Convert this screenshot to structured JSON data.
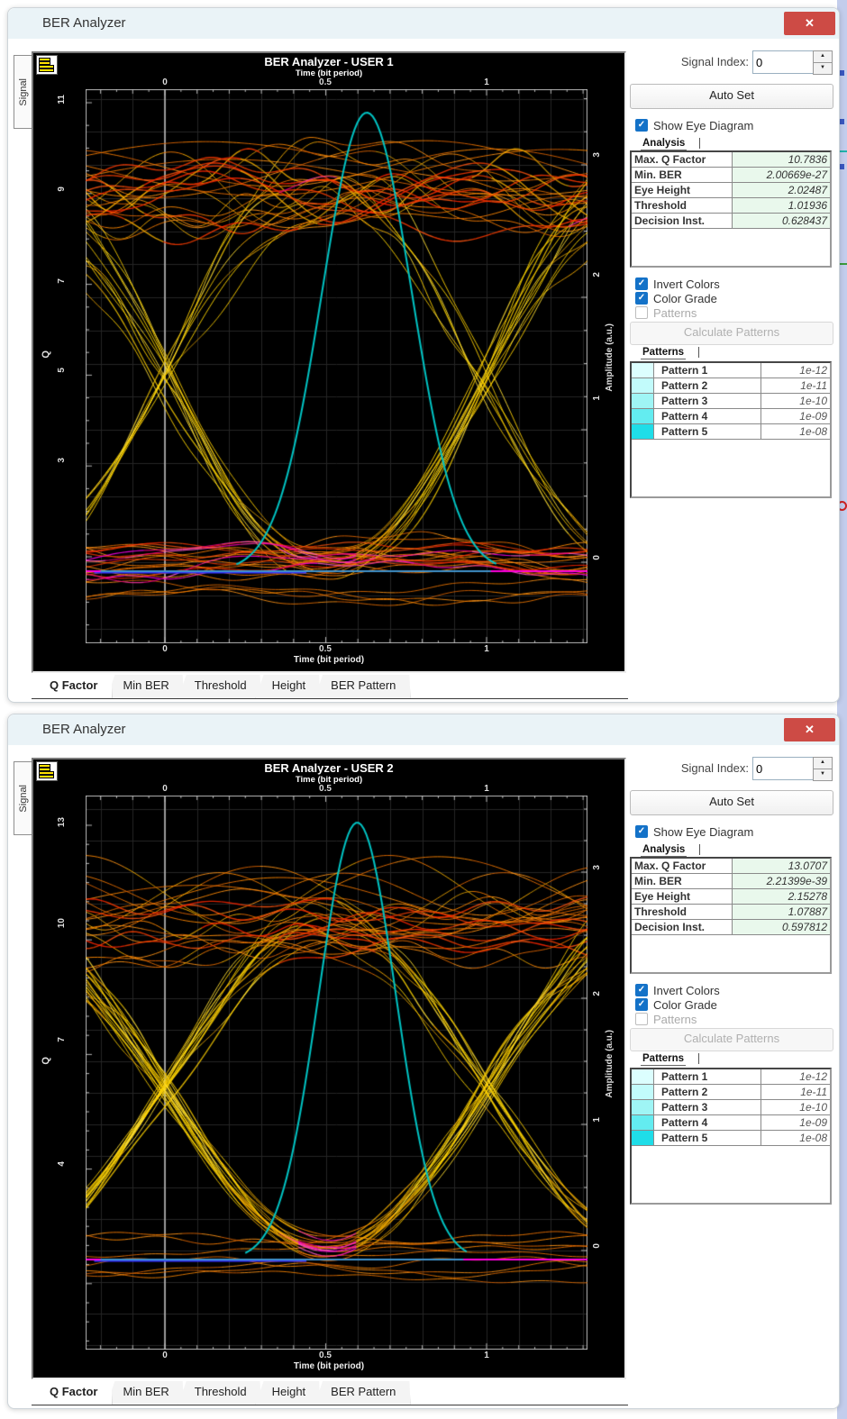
{
  "icons": {
    "close": "✕",
    "check": "✓",
    "spin_up": "▲",
    "spin_down": "▼"
  },
  "windows": [
    {
      "title": "BER Analyzer",
      "side_tab": "Signal",
      "plot": {
        "title": "BER Analyzer - USER 1",
        "subtitle": "Time (bit period)",
        "x_label": "Time (bit period)",
        "x_ticks": [
          "0",
          "0.5",
          "1"
        ],
        "y_left_label": "Q",
        "y_left_ticks": [
          "11",
          "9",
          "7",
          "5",
          "3"
        ],
        "y_right_label": "Amplitude (a.u.)",
        "y_right_ticks": [
          "3",
          "2",
          "1",
          "0"
        ]
      },
      "tabs": [
        "Q Factor",
        "Min BER",
        "Threshold",
        "Height",
        "BER Pattern"
      ],
      "active_tab": 0,
      "panel": {
        "signal_index_label": "Signal Index:",
        "signal_index_value": "0",
        "auto_set": "Auto Set",
        "show_eye": "Show Eye Diagram",
        "show_eye_checked": true,
        "analysis_tab": "Analysis",
        "analysis_rows": [
          [
            "Max. Q Factor",
            "10.7836"
          ],
          [
            "Min. BER",
            "2.00669e-27"
          ],
          [
            "Eye Height",
            "2.02487"
          ],
          [
            "Threshold",
            "1.01936"
          ],
          [
            "Decision Inst.",
            "0.628437"
          ]
        ],
        "invert_colors": "Invert Colors",
        "invert_colors_checked": true,
        "color_grade": "Color Grade",
        "color_grade_checked": true,
        "patterns_label": "Patterns",
        "patterns_checked": false,
        "calculate_patterns": "Calculate Patterns",
        "patterns_tab": "Patterns",
        "pattern_rows": [
          {
            "name": "Pattern 1",
            "value": "1e-12",
            "color": "#dcfefe"
          },
          {
            "name": "Pattern 2",
            "value": "1e-11",
            "color": "#c2fbfb"
          },
          {
            "name": "Pattern 3",
            "value": "1e-10",
            "color": "#9ff5f5"
          },
          {
            "name": "Pattern 4",
            "value": "1e-09",
            "color": "#63ecf0"
          },
          {
            "name": "Pattern 5",
            "value": "1e-08",
            "color": "#1fdde8"
          }
        ]
      },
      "eye": {
        "style": "nrz",
        "seed": 11,
        "t_peak": 0.628,
        "sigma": 0.14
      }
    },
    {
      "title": "BER Analyzer",
      "side_tab": "Signal",
      "plot": {
        "title": "BER Analyzer - USER 2",
        "subtitle": "Time (bit period)",
        "x_label": "Time (bit period)",
        "x_ticks": [
          "0",
          "0.5",
          "1"
        ],
        "y_left_label": "Q",
        "y_left_ticks": [
          "13",
          "10",
          "7",
          "4"
        ],
        "y_right_label": "Amplitude (a.u.)",
        "y_right_ticks": [
          "3",
          "2",
          "1",
          "0"
        ]
      },
      "tabs": [
        "Q Factor",
        "Min BER",
        "Threshold",
        "Height",
        "BER Pattern"
      ],
      "active_tab": 0,
      "panel": {
        "signal_index_label": "Signal Index:",
        "signal_index_value": "0",
        "auto_set": "Auto Set",
        "show_eye": "Show Eye Diagram",
        "show_eye_checked": true,
        "analysis_tab": "Analysis",
        "analysis_rows": [
          [
            "Max. Q Factor",
            "13.0707"
          ],
          [
            "Min. BER",
            "2.21399e-39"
          ],
          [
            "Eye Height",
            "2.15278"
          ],
          [
            "Threshold",
            "1.07887"
          ],
          [
            "Decision Inst.",
            "0.597812"
          ]
        ],
        "invert_colors": "Invert Colors",
        "invert_colors_checked": true,
        "color_grade": "Color Grade",
        "color_grade_checked": true,
        "patterns_label": "Patterns",
        "patterns_checked": false,
        "calculate_patterns": "Calculate Patterns",
        "patterns_tab": "Patterns",
        "pattern_rows": [
          {
            "name": "Pattern 1",
            "value": "1e-12",
            "color": "#dcfefe"
          },
          {
            "name": "Pattern 2",
            "value": "1e-11",
            "color": "#c2fbfb"
          },
          {
            "name": "Pattern 3",
            "value": "1e-10",
            "color": "#9ff5f5"
          },
          {
            "name": "Pattern 4",
            "value": "1e-09",
            "color": "#63ecf0"
          },
          {
            "name": "Pattern 5",
            "value": "1e-08",
            "color": "#1fdde8"
          }
        ]
      },
      "eye": {
        "style": "rz",
        "seed": 29,
        "t_peak": 0.598,
        "sigma": 0.12
      }
    }
  ]
}
